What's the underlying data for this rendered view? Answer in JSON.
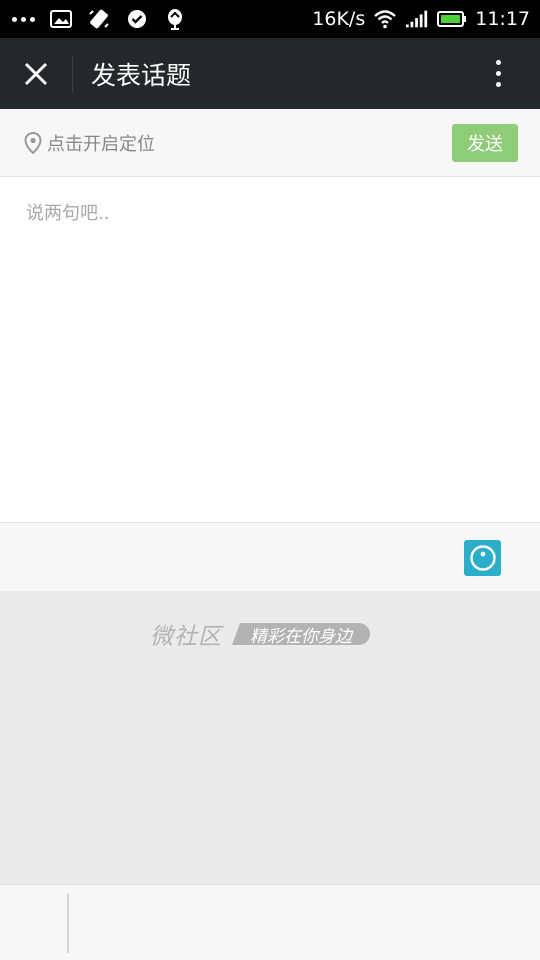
{
  "status_bar": {
    "network_speed": "16K/s",
    "time": "11:17",
    "icons": [
      "more-dots-icon",
      "image-icon",
      "phone-vibrate-icon",
      "check-circle-icon",
      "app-notification-icon",
      "wifi-icon",
      "signal-icon",
      "battery-icon"
    ]
  },
  "header": {
    "title": "发表话题",
    "close_icon": "close-icon",
    "more_icon": "more-vertical-icon"
  },
  "location": {
    "label": "点击开启定位",
    "icon": "location-pin-icon"
  },
  "send_button": {
    "label": "发送",
    "color": "#8fcc78"
  },
  "compose": {
    "placeholder": "说两句吧.."
  },
  "toolbar": {
    "emoji_icon": "emoji-icon",
    "emoji_color": "#2aaec9"
  },
  "branding": {
    "name": "微社区",
    "slogan": "精彩在你身边"
  },
  "colors": {
    "header_bg": "#23282b",
    "status_bg": "#000000",
    "page_bg": "#ebebeb"
  }
}
